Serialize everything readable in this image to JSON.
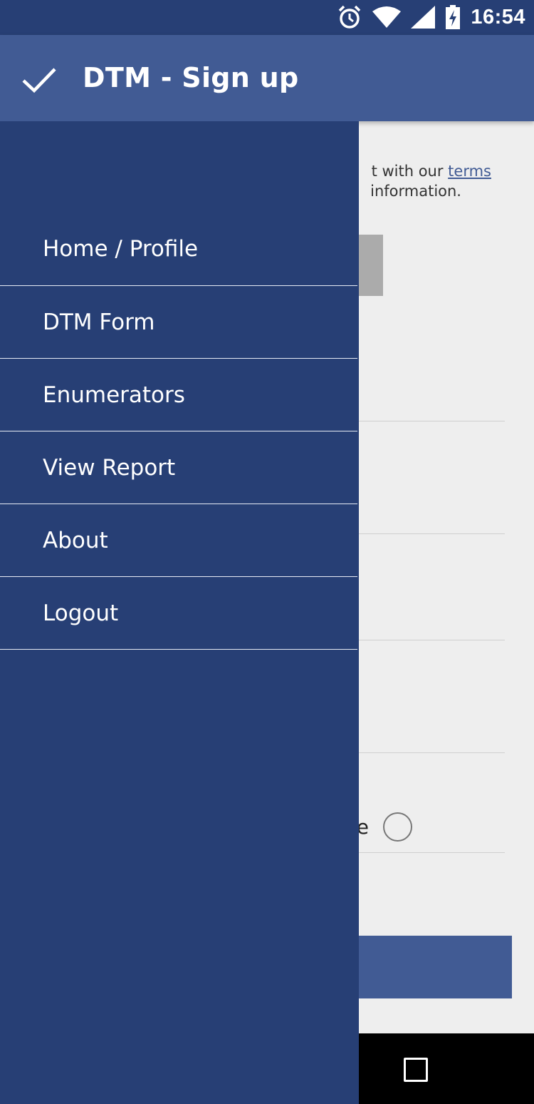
{
  "status_bar": {
    "time": "16:54",
    "icons": [
      "alarm-icon",
      "wifi-icon",
      "signal-icon",
      "battery-charging-icon"
    ]
  },
  "app_bar": {
    "icon": "check-icon",
    "title": "DTM - Sign up"
  },
  "drawer": {
    "items": [
      {
        "label": "Home / Profile"
      },
      {
        "label": "DTM Form"
      },
      {
        "label": "Enumerators"
      },
      {
        "label": "View Report"
      },
      {
        "label": "About"
      },
      {
        "label": "Logout"
      }
    ]
  },
  "background_form": {
    "terms_line1_prefix": "t with our ",
    "terms_link": "terms",
    "terms_line2": "information.",
    "radio_label_fragment": "e"
  },
  "nav_bar": {
    "icons": [
      "recents-icon"
    ]
  },
  "colors": {
    "status_bar": "#273f75",
    "app_bar": "#415b94",
    "drawer": "#273f75",
    "content_bg": "#eeeeee",
    "nav_bar": "#000000"
  }
}
